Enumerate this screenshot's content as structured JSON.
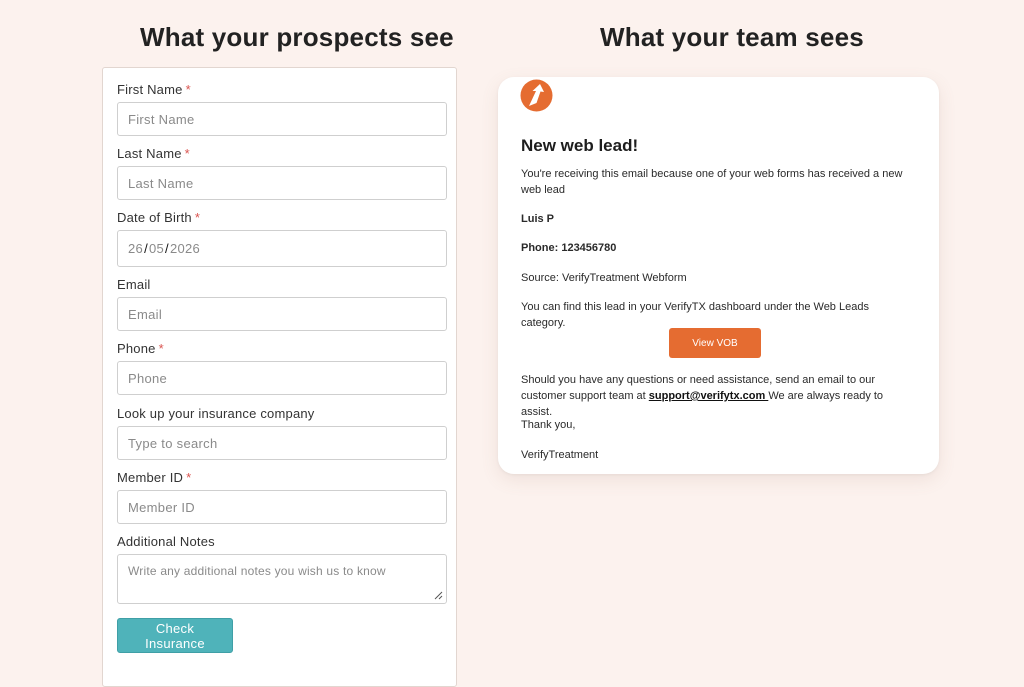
{
  "left_heading": "What your prospects see",
  "right_heading": "What your team sees",
  "form": {
    "first_name": {
      "label": "First Name",
      "required": "*",
      "placeholder": "First Name"
    },
    "last_name": {
      "label": "Last Name",
      "required": "*",
      "placeholder": "Last Name"
    },
    "dob": {
      "label": "Date of Birth",
      "required": "*",
      "day": "26",
      "month": "05",
      "year": "2026",
      "sep": "/"
    },
    "email": {
      "label": "Email",
      "placeholder": "Email"
    },
    "phone": {
      "label": "Phone",
      "required": "*",
      "placeholder": "Phone"
    },
    "insurance": {
      "label": "Look up your insurance company",
      "placeholder": "Type to search"
    },
    "member_id": {
      "label": "Member ID",
      "required": "*",
      "placeholder": "Member ID"
    },
    "notes": {
      "label": "Additional Notes",
      "placeholder": "Write any additional notes you wish us to know"
    },
    "submit_label": "Check Insurance"
  },
  "email": {
    "title": "New web lead!",
    "intro": "You're receiving this email because one of your web forms has received a new web lead",
    "name": "Luis P",
    "phone": "Phone: 123456780",
    "source": "Source: VerifyTreatment Webform",
    "find_text": "You can find this lead in your VerifyTX dashboard under the Web Leads category.",
    "button_label": "View VOB",
    "support_pre": "Should you have any questions or need assistance, send an email to our customer support team at ",
    "support_link": "support@verifytx.com ",
    "support_post": "We are always ready to assist.",
    "thanks": "Thank you,",
    "signature": "VerifyTreatment"
  },
  "colors": {
    "background": "#fcf2ee",
    "button_teal": "#4fb3ba",
    "button_orange": "#e56c31",
    "required": "#d9534f",
    "logo": "#e56c31"
  },
  "icons": {
    "logo": "verifytx-logo-icon",
    "resize": "resize-handle-icon"
  }
}
